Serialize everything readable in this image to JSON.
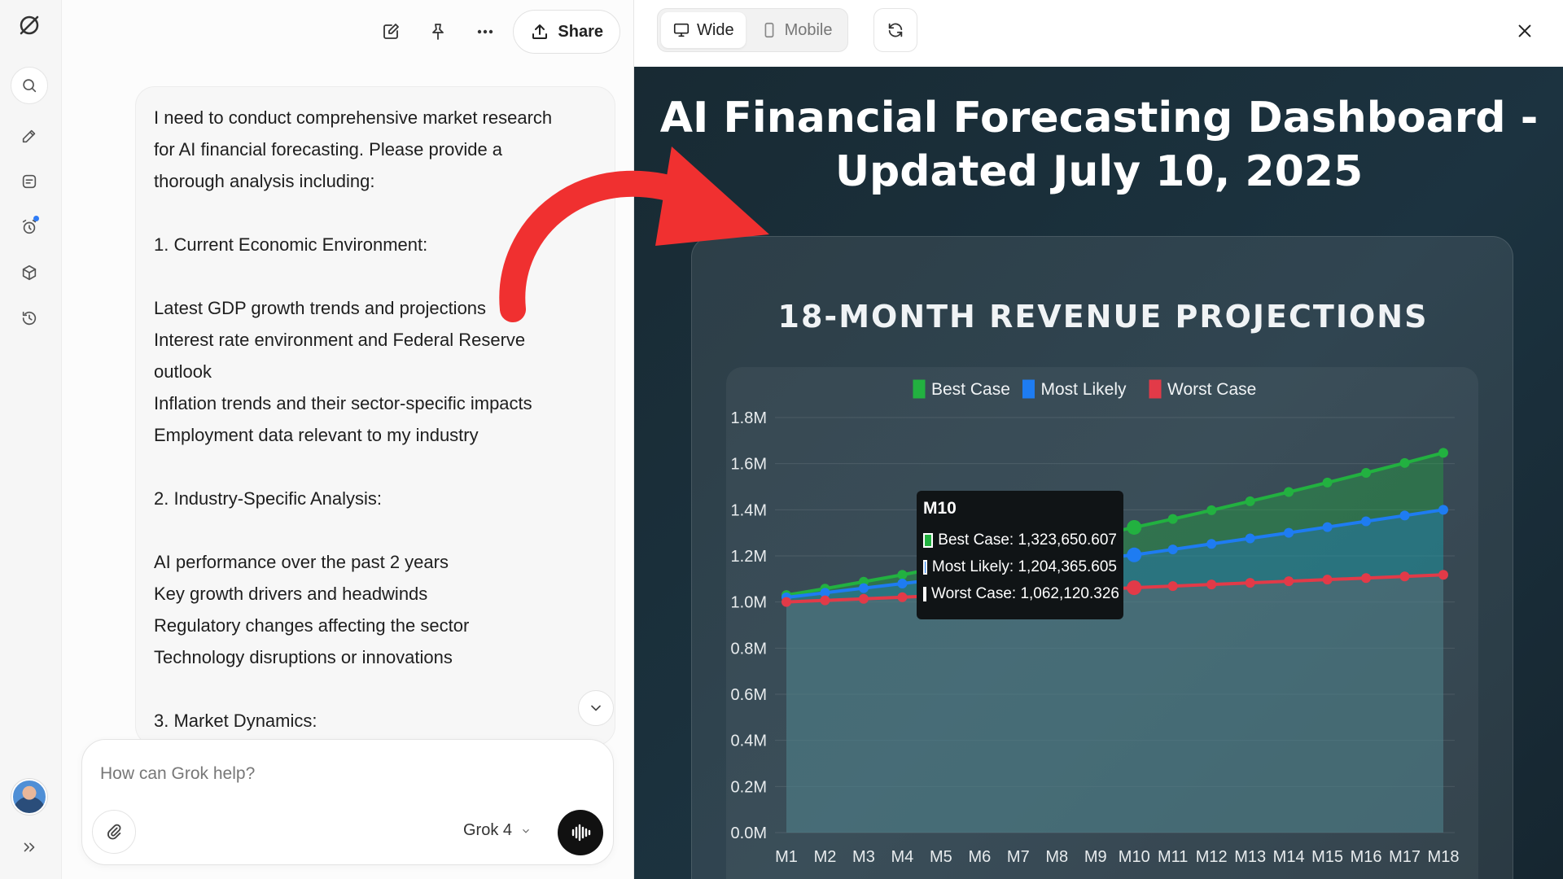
{
  "chat": {
    "share_label": "Share",
    "message_lines": [
      "I need to conduct comprehensive market research",
      "for AI financial forecasting. Please provide a",
      "thorough analysis including:",
      "",
      "1. Current Economic Environment:",
      "",
      "Latest GDP growth trends and projections",
      "Interest rate environment and Federal Reserve",
      "outlook",
      "Inflation trends and their sector-specific impacts",
      "Employment data relevant to my industry",
      "",
      "2. Industry-Specific Analysis:",
      "",
      "AI performance over the past 2 years",
      "Key growth drivers and headwinds",
      "Regulatory changes affecting the sector",
      "Technology disruptions or innovations",
      "",
      "3. Market Dynamics:"
    ],
    "composer_placeholder": "How can Grok help?",
    "model_label": "Grok 4"
  },
  "preview": {
    "wide_label": "Wide",
    "mobile_label": "Mobile",
    "dashboard_title_line1": "AI Financial Forecasting Dashboard -",
    "dashboard_title_line2": "Updated July 10, 2025",
    "chart_title": "18-MONTH REVENUE PROJECTIONS"
  },
  "tooltip": {
    "title": "M10",
    "rows": [
      {
        "label": "Best Case: 1,323,650.607",
        "color": "#22b140"
      },
      {
        "label": "Most Likely: 1,204,365.605",
        "color": "#1e7cf2"
      },
      {
        "label": "Worst Case: 1,062,120.326",
        "color": "#e23a48"
      }
    ]
  },
  "chart_data": {
    "type": "area",
    "title": "18-MONTH REVENUE PROJECTIONS",
    "categories": [
      "M1",
      "M2",
      "M3",
      "M4",
      "M5",
      "M6",
      "M7",
      "M8",
      "M9",
      "M10",
      "M11",
      "M12",
      "M13",
      "M14",
      "M15",
      "M16",
      "M17",
      "M18"
    ],
    "y_ticks": [
      "0.0M",
      "0.2M",
      "0.4M",
      "0.6M",
      "0.8M",
      "1.0M",
      "1.2M",
      "1.4M",
      "1.6M",
      "1.8M"
    ],
    "ylim": [
      0,
      1800000
    ],
    "legend_position": "top",
    "grid": true,
    "series": [
      {
        "name": "Best Case",
        "color": "#22b140",
        "values": [
          1030000,
          1058000,
          1088000,
          1118000,
          1150000,
          1183000,
          1217000,
          1252000,
          1288000,
          1323651,
          1360000,
          1398000,
          1437000,
          1477000,
          1518000,
          1560000,
          1603000,
          1647000
        ]
      },
      {
        "name": "Most Likely",
        "color": "#1e7cf2",
        "values": [
          1020000,
          1040000,
          1060000,
          1080000,
          1100000,
          1122000,
          1144000,
          1166000,
          1188000,
          1204366,
          1228000,
          1252000,
          1276000,
          1300000,
          1325000,
          1350000,
          1375000,
          1400000
        ]
      },
      {
        "name": "Worst Case",
        "color": "#e23a48",
        "values": [
          1000000,
          1007000,
          1014000,
          1021000,
          1028000,
          1035000,
          1042000,
          1049000,
          1055000,
          1062120,
          1069000,
          1076000,
          1083000,
          1090000,
          1097000,
          1104000,
          1111000,
          1118000
        ]
      }
    ]
  },
  "colors": {
    "accent_red_arrow": "#f03030",
    "dashboard_bg": "#1c3340"
  }
}
